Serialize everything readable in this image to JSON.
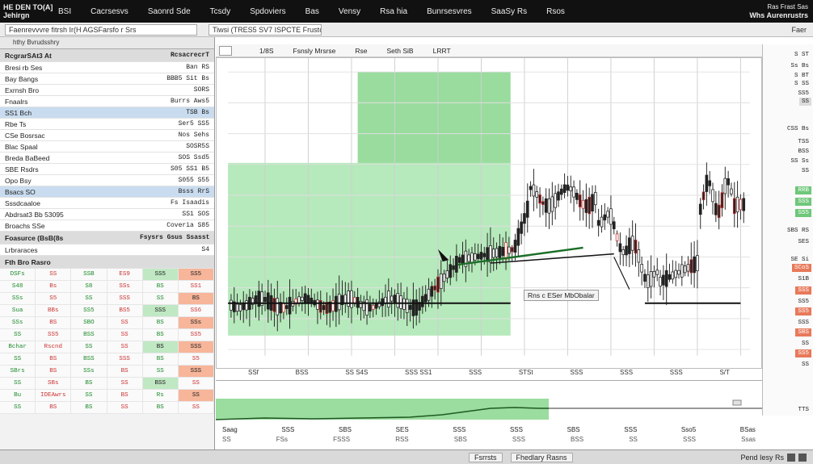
{
  "menubar": {
    "brand_line1": "HE DEN TO(A]",
    "brand_line2": "Jehirgn",
    "items": [
      "BSI",
      "Cacrsesvs",
      "Saonrd Sde",
      "Tcsdy",
      "Spdoviers",
      "Bas",
      "Vensy",
      "Rsa hia",
      "Bunrsesvres",
      "SaaSy Rs",
      "Rsos"
    ],
    "right_top": "Ras Frast Sas",
    "right_sub": "Whs Aurenrustrs"
  },
  "toolbar": {
    "field1": "Faenrevvvre fitrsh Ir(H AGSFarsfo r Srs",
    "field2": "Tiwsi (TRES5 SV7 ISPCTE Frustci",
    "right": "Faer"
  },
  "left_panel": {
    "header": "hthy Bvrudsshry",
    "rows": [
      {
        "label": "RcgrarSAt3 At",
        "value": "RcsacrecrT",
        "style": "head"
      },
      {
        "label": "Bresi rb Ses",
        "value": "Ban RS",
        "style": ""
      },
      {
        "label": "Bay Bangs",
        "value": "BBB5 Sit Bs",
        "style": ""
      },
      {
        "label": "Exrnsh Bro",
        "value": "SORS",
        "style": ""
      },
      {
        "label": "Fnaalrs",
        "value": "Burrs Aws5",
        "style": ""
      },
      {
        "label": "SS1 Bch",
        "value": "TSB Bs",
        "style": "sel"
      },
      {
        "label": "Rbe Ts",
        "value": "Ser5 SS5",
        "style": ""
      },
      {
        "label": "CSe Bosrsac",
        "value": "Nos Sehs",
        "style": ""
      },
      {
        "label": "Blac Spaal",
        "value": "SOSR5S",
        "style": ""
      },
      {
        "label": "Breda BaBeed",
        "value": "SOS Ssd5",
        "style": ""
      },
      {
        "label": "SBE Rsdrs",
        "value": "S05 SS1 B5",
        "style": ""
      },
      {
        "label": "Opo Bsy",
        "value": "S055 S55",
        "style": ""
      },
      {
        "label": "Bsacs SO",
        "value": "Bsss RrS",
        "style": "sel"
      },
      {
        "label": "Sssdcaaloe",
        "value": "Fs Isaadis",
        "style": ""
      },
      {
        "label": "Abdrsat3 Bb 53095",
        "value": "SS1 SOS",
        "style": ""
      },
      {
        "label": "Broachs SSe",
        "value": "Coveria S85",
        "style": ""
      },
      {
        "label": "Foasurce (BsB(8s",
        "value": "Fsysrs Gsus Ssasst",
        "style": "head"
      },
      {
        "label": "Lrbraraces",
        "value": "S4",
        "style": ""
      }
    ],
    "grid_title": "Fth Bro Rasro",
    "grid": [
      [
        "DSFs",
        "SS",
        "SSB",
        "ES9",
        "SS5",
        "SS5"
      ],
      [
        "S48",
        "Bs",
        "S8",
        "SSs",
        "BS",
        "SS1"
      ],
      [
        "SSs",
        "S5",
        "SS",
        "SSS",
        "SS",
        "BS"
      ],
      [
        "Sua",
        "BBs",
        "SS5",
        "BS5",
        "SSS",
        "SS6"
      ],
      [
        "SSs",
        "BS",
        "SBO",
        "SS",
        "BS",
        "SSs"
      ],
      [
        "SS",
        "SS5",
        "BSS",
        "SS",
        "BS",
        "SS5"
      ],
      [
        "Bchar",
        "Rscnd",
        "SS",
        "SS",
        "BS",
        "SSS"
      ],
      [
        "SS",
        "BS",
        "BSS",
        "SSS",
        "BS",
        "S5"
      ],
      [
        "SBrs",
        "BS",
        "SSs",
        "BS",
        "SS",
        "SSS"
      ],
      [
        "SS",
        "SBs",
        "BS",
        "SS",
        "BSS",
        "SS"
      ],
      [
        "Bu",
        "IDEAwrs",
        "SS",
        "BS",
        "Rs",
        "SS"
      ],
      [
        "SS",
        "BS",
        "BS",
        "SS",
        "BS",
        "SS"
      ]
    ]
  },
  "chart_header": {
    "items": [
      "1/8S",
      "Fsnsly Mrsrse",
      "Rse",
      "Seth SiB",
      "LRRT"
    ]
  },
  "chart_legend": "Rns c ESer MbObalar",
  "xaxis": [
    "SSf",
    "BSS",
    "SS S4S",
    "SSS SS1",
    "SSS",
    "STSt",
    "SSS",
    "SSS",
    "SSS",
    "S/T"
  ],
  "right_scale": [
    {
      "t": 8,
      "text": "S  ST",
      "style": ""
    },
    {
      "t": 22,
      "text": "Ss Bs",
      "style": ""
    },
    {
      "t": 34,
      "text": "S BT",
      "style": ""
    },
    {
      "t": 44,
      "text": "S SS",
      "style": ""
    },
    {
      "t": 56,
      "text": "SS5",
      "style": ""
    },
    {
      "t": 66,
      "text": "SS",
      "style": "gr"
    },
    {
      "t": 100,
      "text": "CSS Bs",
      "style": ""
    },
    {
      "t": 116,
      "text": "TSS",
      "style": ""
    },
    {
      "t": 128,
      "text": "BSS",
      "style": ""
    },
    {
      "t": 140,
      "text": "SS Ss",
      "style": ""
    },
    {
      "t": 152,
      "text": "SS",
      "style": ""
    },
    {
      "t": 176,
      "text": "RRB",
      "style": "g"
    },
    {
      "t": 190,
      "text": "SSS",
      "style": "g"
    },
    {
      "t": 204,
      "text": "SS5",
      "style": "g"
    },
    {
      "t": 226,
      "text": "SBS RS",
      "style": ""
    },
    {
      "t": 240,
      "text": "SES",
      "style": ""
    },
    {
      "t": 262,
      "text": "SE Si",
      "style": ""
    },
    {
      "t": 272,
      "text": "SCoS",
      "style": "r"
    },
    {
      "t": 286,
      "text": "S1B",
      "style": ""
    },
    {
      "t": 300,
      "text": "SSS",
      "style": "r"
    },
    {
      "t": 314,
      "text": "SS5",
      "style": ""
    },
    {
      "t": 326,
      "text": "SS5",
      "style": "r"
    },
    {
      "t": 340,
      "text": "SSS",
      "style": ""
    },
    {
      "t": 352,
      "text": "SBS",
      "style": "r"
    },
    {
      "t": 366,
      "text": "SS",
      "style": ""
    },
    {
      "t": 378,
      "text": "SS5",
      "style": "r"
    },
    {
      "t": 392,
      "text": "SS",
      "style": ""
    },
    {
      "t": 448,
      "text": "TTS",
      "style": ""
    }
  ],
  "lower_panel": {
    "row1": [
      "Saag",
      "SSS",
      "SBS",
      "SES",
      "SSS",
      "SSS",
      "SBS",
      "SSS",
      "Sso5",
      "BSas"
    ],
    "row2": [
      "SS",
      "FSs",
      "FSSS",
      "RSS",
      "SBS",
      "SSS",
      "BSS",
      "SS",
      "SSS",
      "Ssas"
    ]
  },
  "status": {
    "center": [
      "Fsrrsts",
      "Fhedlary Rasns"
    ],
    "right": "Pend Iesy Rs"
  }
}
